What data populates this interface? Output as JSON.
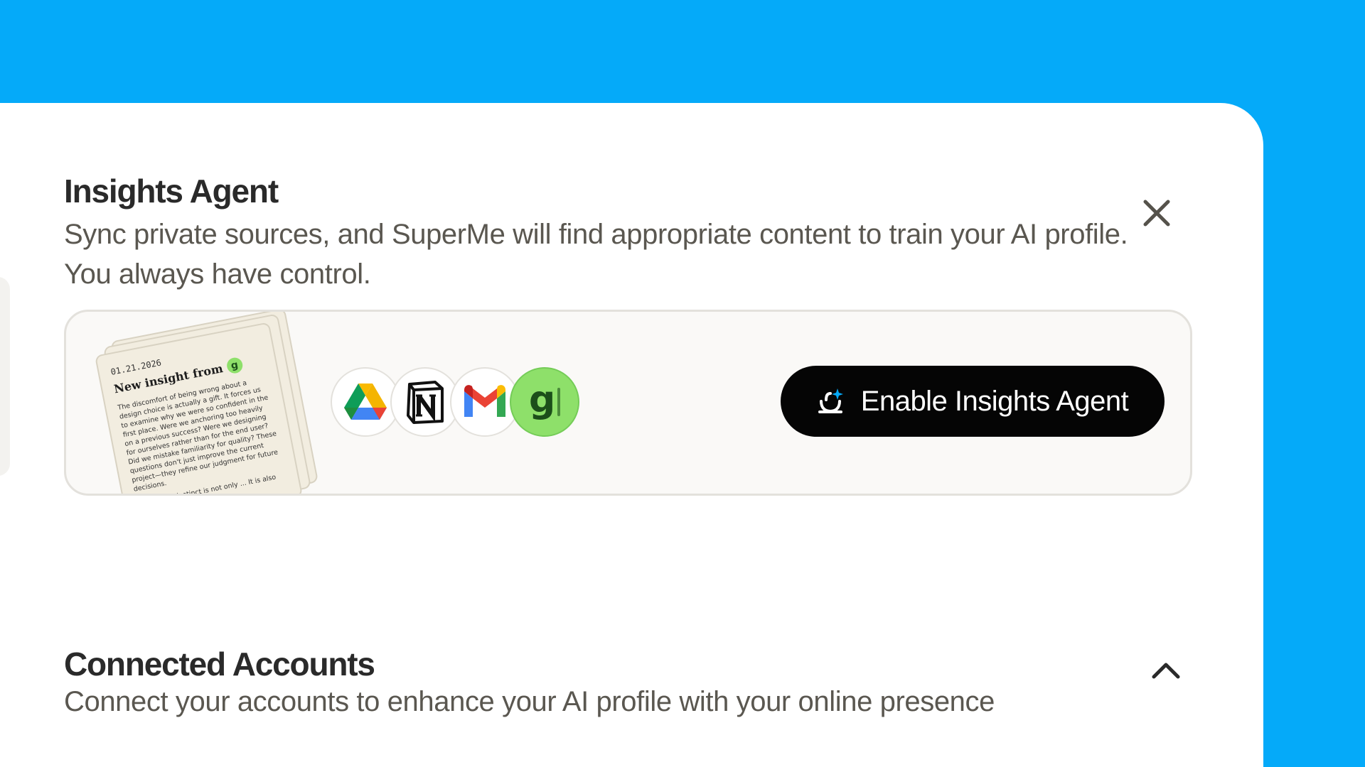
{
  "modal": {
    "title": "Insights Agent",
    "description": "Sync private sources, and SuperMe will find appropriate content to train your AI profile. You always have control.",
    "close_icon": "close-icon"
  },
  "insights_card": {
    "paper": {
      "date": "01.21.2026",
      "headline": "New insight from",
      "badge": "g",
      "body": "The discomfort of being wrong about a design choice is actually a gift. It forces us to examine why we were so confident in the first place. Were we anchoring too heavily on a previous success? Were we designing for ourselves rather than for the end user? Did we mistake familiarity for quality? These questions don't just improve the current project—they refine our judgment for future decisions.",
      "body2": "...that good instinct is not only ... It is also about"
    },
    "sources": [
      "google-drive-icon",
      "notion-icon",
      "gmail-icon",
      "granola-icon"
    ],
    "enable_button": {
      "label": "Enable Insights Agent",
      "icon": "agent-spark-icon"
    }
  },
  "connected_accounts": {
    "title": "Connected Accounts",
    "description": "Connect your accounts to enhance your AI profile with your online presence",
    "toggle_icon": "chevron-up-icon"
  },
  "colors": {
    "background": "#05aaf9",
    "card": "#ffffff",
    "button": "#050505",
    "granola_green": "#8ee06a"
  }
}
